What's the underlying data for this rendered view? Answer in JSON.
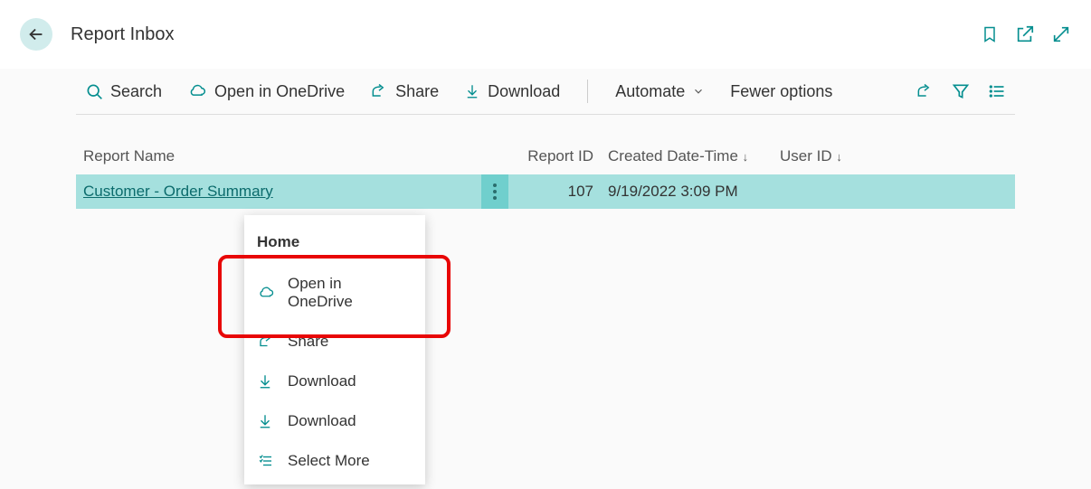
{
  "header": {
    "title": "Report Inbox"
  },
  "commands": {
    "search": "Search",
    "open_onedrive": "Open in OneDrive",
    "share": "Share",
    "download": "Download",
    "automate": "Automate",
    "fewer_options": "Fewer options"
  },
  "columns": {
    "name": "Report Name",
    "id": "Report ID",
    "created": "Created Date-Time",
    "user": "User ID"
  },
  "row": {
    "name": "Customer - Order Summary",
    "id": "107",
    "created": "9/19/2022 3:09 PM",
    "user": ""
  },
  "context_menu": {
    "heading": "Home",
    "open_onedrive": "Open in OneDrive",
    "share": "Share",
    "download1": "Download",
    "download2": "Download",
    "select_more": "Select More"
  }
}
